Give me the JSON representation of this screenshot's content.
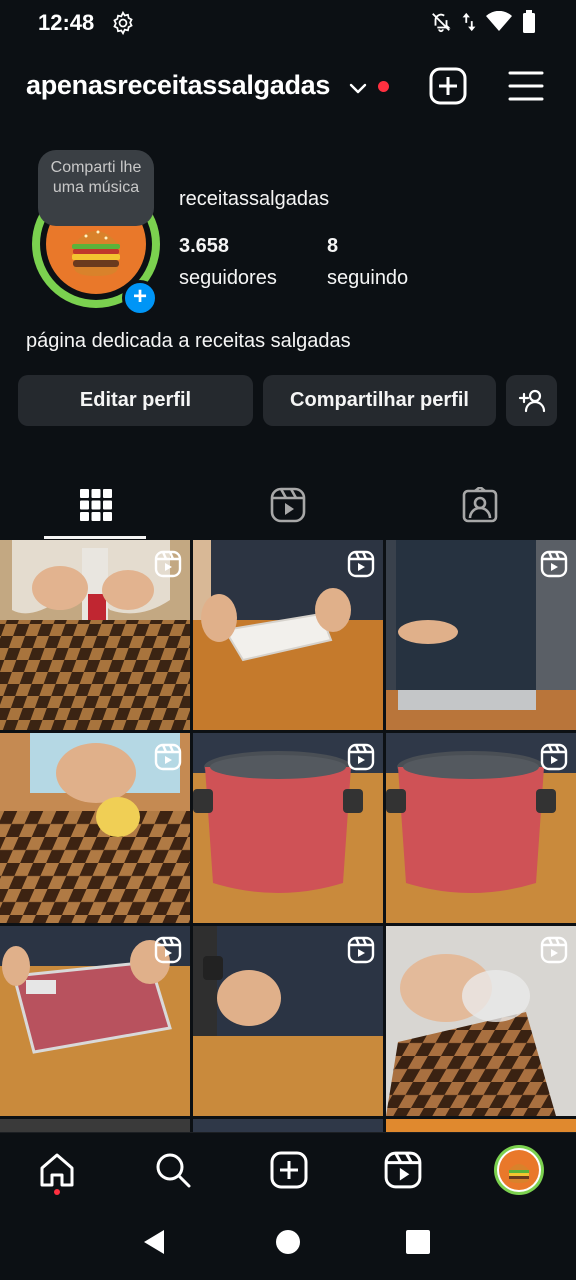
{
  "statusbar": {
    "time": "12:48",
    "icons": [
      "gear-icon",
      "bell-off-icon",
      "data-arrows-icon",
      "wifi-icon",
      "battery-icon"
    ]
  },
  "header": {
    "username": "apenasreceitassalgadas",
    "has_notification_dot": true,
    "icons": [
      "chevron-down-icon",
      "new-post-icon",
      "menu-icon"
    ]
  },
  "profile": {
    "note": "Comparti lhe uma música",
    "name": "receitassalgadas",
    "followers_count": "3.658",
    "followers_label": "seguidores",
    "following_count": "8",
    "following_label": "seguindo",
    "bio": "página dedicada a receitas salgadas"
  },
  "actions": {
    "edit_label": "Editar perfil",
    "share_label": "Compartilhar perfil"
  },
  "tabs": [
    "grid-icon",
    "reels-icon",
    "tagged-icon"
  ],
  "grid": {
    "items": 9,
    "type_badge": "reel-icon"
  },
  "bottom_nav": [
    "home-icon",
    "search-icon",
    "create-icon",
    "reels-icon",
    "profile-avatar"
  ],
  "colors": {
    "background": "#0c1014",
    "button": "#25292e",
    "accent_blue": "#0095f6",
    "notification_red": "#ff3040",
    "story_ring": "#7bd14f"
  }
}
